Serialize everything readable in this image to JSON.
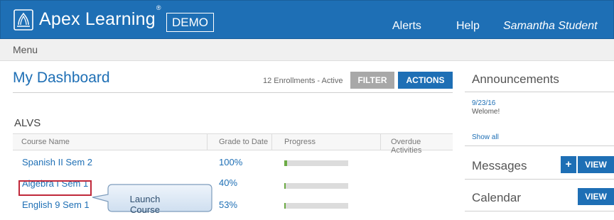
{
  "header": {
    "brand": "Apex Learning",
    "brand_mark": "®",
    "demo_label": "DEMO",
    "nav": {
      "alerts": "Alerts",
      "help": "Help",
      "user": "Samantha Student"
    }
  },
  "menu": {
    "label": "Menu"
  },
  "dashboard": {
    "title": "My Dashboard",
    "enrollments": "12 Enrollments - Active",
    "filter_label": "FILTER",
    "actions_label": "ACTIONS"
  },
  "section": {
    "title": "ALVS",
    "columns": {
      "course": "Course Name",
      "grade": "Grade to Date",
      "progress": "Progress",
      "overdue": "Overdue Activities"
    },
    "rows": [
      {
        "course": "Spanish II Sem 2",
        "grade": "100%",
        "progress": 0.04
      },
      {
        "course": "Algebra I Sem 1",
        "grade": "40%",
        "progress": 0.02
      },
      {
        "course": "English 9 Sem 1",
        "grade": "53%",
        "progress": 0.02
      }
    ]
  },
  "callout": {
    "label": "Launch Course"
  },
  "sidebar": {
    "announcements": {
      "title": "Announcements",
      "date": "9/23/16",
      "text": "Welome!",
      "show_all": "Show all"
    },
    "messages": {
      "title": "Messages",
      "add_label": "+",
      "view_label": "VIEW"
    },
    "calendar": {
      "title": "Calendar",
      "view_label": "VIEW"
    }
  },
  "colors": {
    "brand_blue": "#1e6fb5",
    "progress_green": "#6cab45",
    "highlight_red": "#c0283a",
    "callout_fill": "#dbe8f5"
  }
}
